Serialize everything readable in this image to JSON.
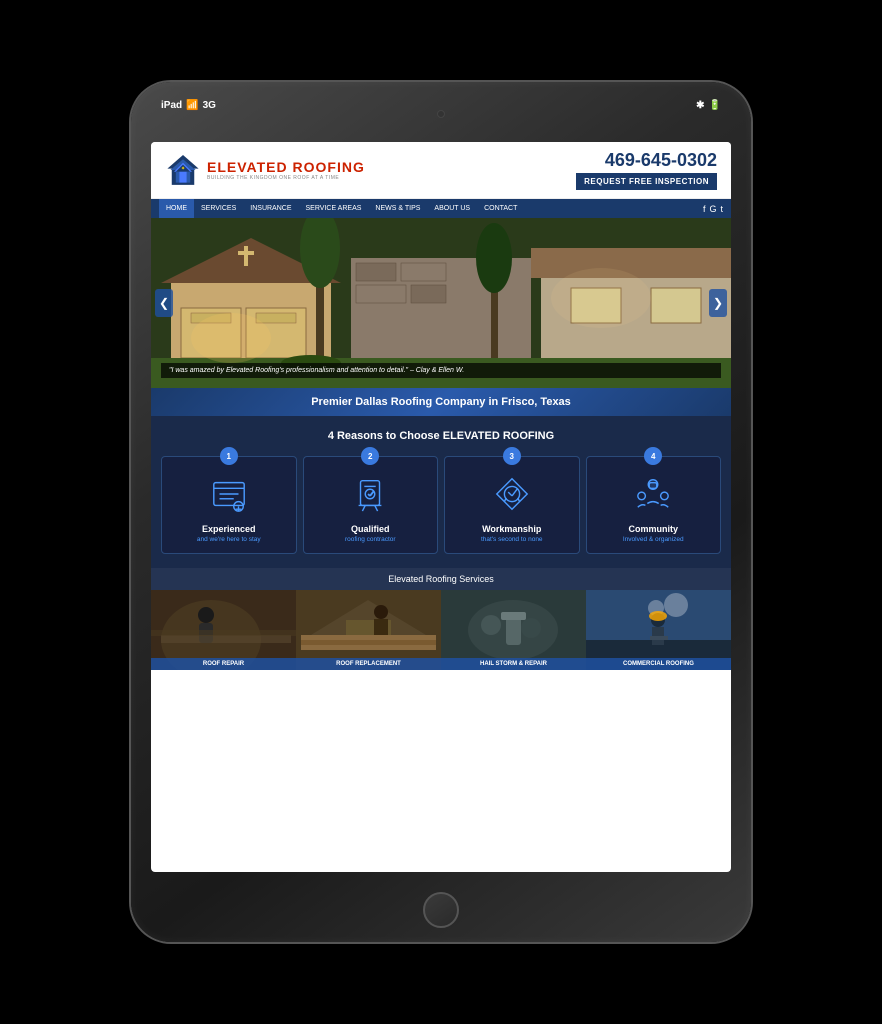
{
  "device": {
    "status_bar": {
      "device": "iPad",
      "wifi": "3G",
      "bluetooth": "✱",
      "battery": "▓▓▓"
    }
  },
  "header": {
    "logo_name_part1": "ELEVATED",
    "logo_name_part2": "ROOFING",
    "logo_tagline": "BUILDING THE KINGDOM ONE ROOF AT A TIME",
    "phone": "469-645-0302",
    "cta_button": "REQUEST FREE INSPECTION"
  },
  "nav": {
    "items": [
      {
        "label": "HOME",
        "active": true
      },
      {
        "label": "SERVICES"
      },
      {
        "label": "INSURANCE"
      },
      {
        "label": "SERVICE AREAS"
      },
      {
        "label": "NEWS & TIPS"
      },
      {
        "label": "ABOUT US"
      },
      {
        "label": "CONTACT"
      }
    ],
    "social": [
      "f",
      "G",
      "t"
    ]
  },
  "hero": {
    "quote": "\"I was amazed by Elevated Roofing's professionalism and attention to detail.\" – Clay & Ellen W.",
    "arrow_left": "❮",
    "arrow_right": "❯"
  },
  "banner": {
    "text": "Premier Dallas Roofing Company in Frisco, Texas"
  },
  "reasons": {
    "title_prefix": "4 Reasons to Choose",
    "title_brand": "ELEVATED ROOFING",
    "cards": [
      {
        "num": "1",
        "title": "Experienced",
        "sub": "and we're here to stay"
      },
      {
        "num": "2",
        "title": "Qualified",
        "sub": "roofing contractor"
      },
      {
        "num": "3",
        "title": "Workmanship",
        "sub": "that's second to none"
      },
      {
        "num": "4",
        "title": "Community",
        "sub": "Involved & organized"
      }
    ]
  },
  "services": {
    "title": "Elevated Roofing Services",
    "items": [
      {
        "label": "Roof Repair"
      },
      {
        "label": "Roof Replacement"
      },
      {
        "label": "Hail Storm & Repair"
      },
      {
        "label": "Commercial Roofing"
      }
    ]
  }
}
